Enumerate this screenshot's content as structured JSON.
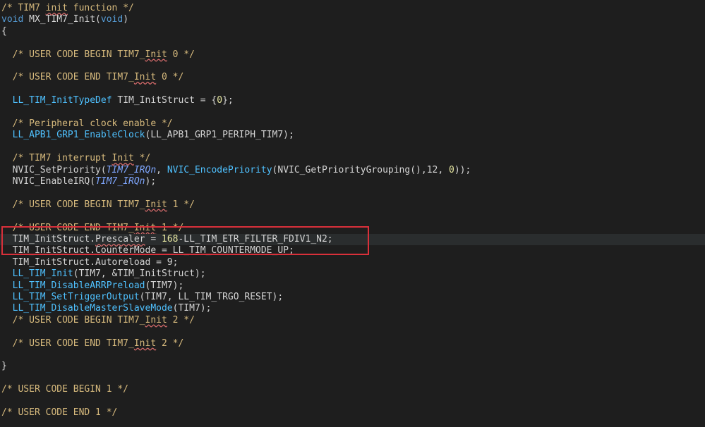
{
  "code_lines": [
    {
      "parts": [
        [
          "c",
          "/* TIM7 "
        ],
        [
          "c sq",
          "init"
        ],
        [
          "c",
          " function */"
        ]
      ]
    },
    {
      "parts": [
        [
          "kw",
          "void"
        ],
        [
          "id",
          " MX_TIM7_Init("
        ],
        [
          "kw",
          "void"
        ],
        [
          "id",
          ")"
        ]
      ]
    },
    {
      "parts": [
        [
          "id",
          "{"
        ]
      ]
    },
    {
      "parts": []
    },
    {
      "parts": [
        [
          "c",
          "  /* USER CODE BEGIN TIM7_"
        ],
        [
          "c sq",
          "Init"
        ],
        [
          "c",
          " 0 */"
        ]
      ]
    },
    {
      "parts": []
    },
    {
      "parts": [
        [
          "c",
          "  /* USER CODE END TIM7_"
        ],
        [
          "c sq",
          "Init"
        ],
        [
          "c",
          " 0 */"
        ]
      ]
    },
    {
      "parts": []
    },
    {
      "parts": [
        [
          "fn",
          "  LL_TIM_InitTypeDef"
        ],
        [
          "id",
          " TIM_InitStruct = {"
        ],
        [
          "num",
          "0"
        ],
        [
          "id",
          "};"
        ]
      ]
    },
    {
      "parts": []
    },
    {
      "parts": [
        [
          "c",
          "  /* Peripheral clock enable */"
        ]
      ]
    },
    {
      "parts": [
        [
          "fn",
          "  LL_APB1_GRP1_EnableClock"
        ],
        [
          "id",
          "(LL_APB1_GRP1_PERIPH_TIM7);"
        ]
      ]
    },
    {
      "parts": []
    },
    {
      "parts": [
        [
          "c",
          "  /* TIM7 interrupt "
        ],
        [
          "c sq",
          "Init"
        ],
        [
          "c",
          " */"
        ]
      ]
    },
    {
      "parts": [
        [
          "id",
          "  NVIC_SetPriority("
        ],
        [
          "it",
          "TIM7_IRQn"
        ],
        [
          "id",
          ", "
        ],
        [
          "fn",
          "NVIC_EncodePriority"
        ],
        [
          "id",
          "(NVIC_GetPriorityGrouping(),12, "
        ],
        [
          "num",
          "0"
        ],
        [
          "id",
          "));"
        ]
      ]
    },
    {
      "parts": [
        [
          "id",
          "  NVIC_EnableIRQ("
        ],
        [
          "it",
          "TIM7_IRQn"
        ],
        [
          "id",
          ");"
        ]
      ]
    },
    {
      "parts": []
    },
    {
      "parts": [
        [
          "c",
          "  /* USER CODE BEGIN TIM7_"
        ],
        [
          "c sq",
          "Init"
        ],
        [
          "c",
          " 1 */"
        ]
      ]
    },
    {
      "parts": []
    },
    {
      "parts": [
        [
          "c",
          "  /* USER CODE END TIM7_"
        ],
        [
          "c sq",
          "Init"
        ],
        [
          "c",
          " 1 */"
        ]
      ]
    },
    {
      "parts": [
        [
          "id",
          "  TIM_InitStruct."
        ],
        [
          "id sq",
          "Prescaler"
        ],
        [
          "id",
          " = "
        ],
        [
          "num",
          "168"
        ],
        [
          "id",
          "-LL_TIM_ETR_FILTER_FDIV1_N2;"
        ]
      ],
      "current": true
    },
    {
      "parts": [
        [
          "id",
          "  TIM_InitStruct.CounterMode = LL_TIM_COUNTERMODE_UP;"
        ]
      ]
    },
    {
      "parts": [
        [
          "id",
          "  TIM_InitStruct.Autoreload = 9;"
        ]
      ]
    },
    {
      "parts": [
        [
          "fn",
          "  LL_TIM_Init"
        ],
        [
          "id",
          "(TIM7, &TIM_InitStruct);"
        ]
      ]
    },
    {
      "parts": [
        [
          "fn",
          "  LL_TIM_DisableARRPreload"
        ],
        [
          "id",
          "(TIM7);"
        ]
      ]
    },
    {
      "parts": [
        [
          "fn",
          "  LL_TIM_SetTriggerOutput"
        ],
        [
          "id",
          "(TIM7, LL_TIM_TRGO_RESET);"
        ]
      ]
    },
    {
      "parts": [
        [
          "fn",
          "  LL_TIM_DisableMasterSlaveMode"
        ],
        [
          "id",
          "(TIM7);"
        ]
      ]
    },
    {
      "parts": [
        [
          "c",
          "  /* USER CODE BEGIN TIM7_"
        ],
        [
          "c sq",
          "Init"
        ],
        [
          "c",
          " 2 */"
        ]
      ]
    },
    {
      "parts": []
    },
    {
      "parts": [
        [
          "c",
          "  /* USER CODE END TIM7_"
        ],
        [
          "c sq",
          "Init"
        ],
        [
          "c",
          " 2 */"
        ]
      ]
    },
    {
      "parts": []
    },
    {
      "parts": [
        [
          "id",
          "}"
        ]
      ]
    },
    {
      "parts": []
    },
    {
      "parts": [
        [
          "c",
          "/* USER CODE BEGIN 1 */"
        ]
      ]
    },
    {
      "parts": []
    },
    {
      "parts": [
        [
          "c",
          "/* USER CODE END 1 */"
        ]
      ]
    }
  ],
  "colors": {
    "background": "#1e1e1e",
    "highlight_box": "#d9303a"
  }
}
